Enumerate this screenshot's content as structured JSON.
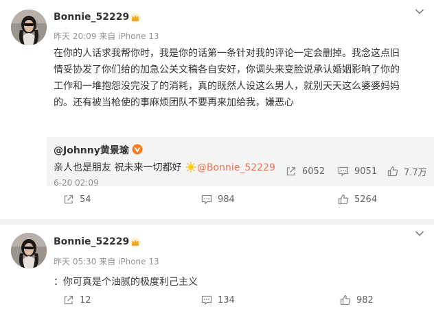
{
  "posts": [
    {
      "username": "Bonnie_52229",
      "meta": "昨天 20:09  来自 iPhone 13",
      "body_lines": [
        "在你的人话求我帮你时，我是你的话第一条针对我的评论一定会删掉。我念这点旧",
        "情妥协发了你们给的加急公关文稿各自安好，你调头来变脸说承认婚姻影响了你的",
        "工作和一堆抱怨没完没了的消耗，真的既然人设这么男人，就别天天这么婆婆妈妈",
        "的。还有被当枪使的事麻烦团队不要再来加给我，嫌恶心"
      ],
      "quote": {
        "username": "@Johnny黄景瑜",
        "text_main": "亲人也是朋友 祝未来一切都好",
        "mention": "@Bonnie_52229",
        "date": "6-20 02:09",
        "shares": "6052",
        "comments": "9051",
        "likes": "7.7万"
      },
      "actions": {
        "shares": "54",
        "comments": "984",
        "likes": "5264"
      }
    },
    {
      "username": "Bonnie_52229",
      "meta": "昨天 05:30  来自 iPhone 13",
      "body_lines": [
        "：你可真是个油腻的极度利己主义"
      ],
      "actions": {
        "shares": "12",
        "comments": "134",
        "likes": "982"
      }
    }
  ],
  "colors": {
    "mention": "#eb7350",
    "muted": "#939393",
    "quote_bg": "#f4f4f4",
    "vip_gold": "#f5a623",
    "verified_orange": "#f57e22"
  },
  "icons": [
    "crown-vip-icon",
    "chevron-down-icon",
    "verified-badge-icon",
    "sun-emoji-icon",
    "share-icon",
    "comment-icon",
    "like-icon"
  ]
}
